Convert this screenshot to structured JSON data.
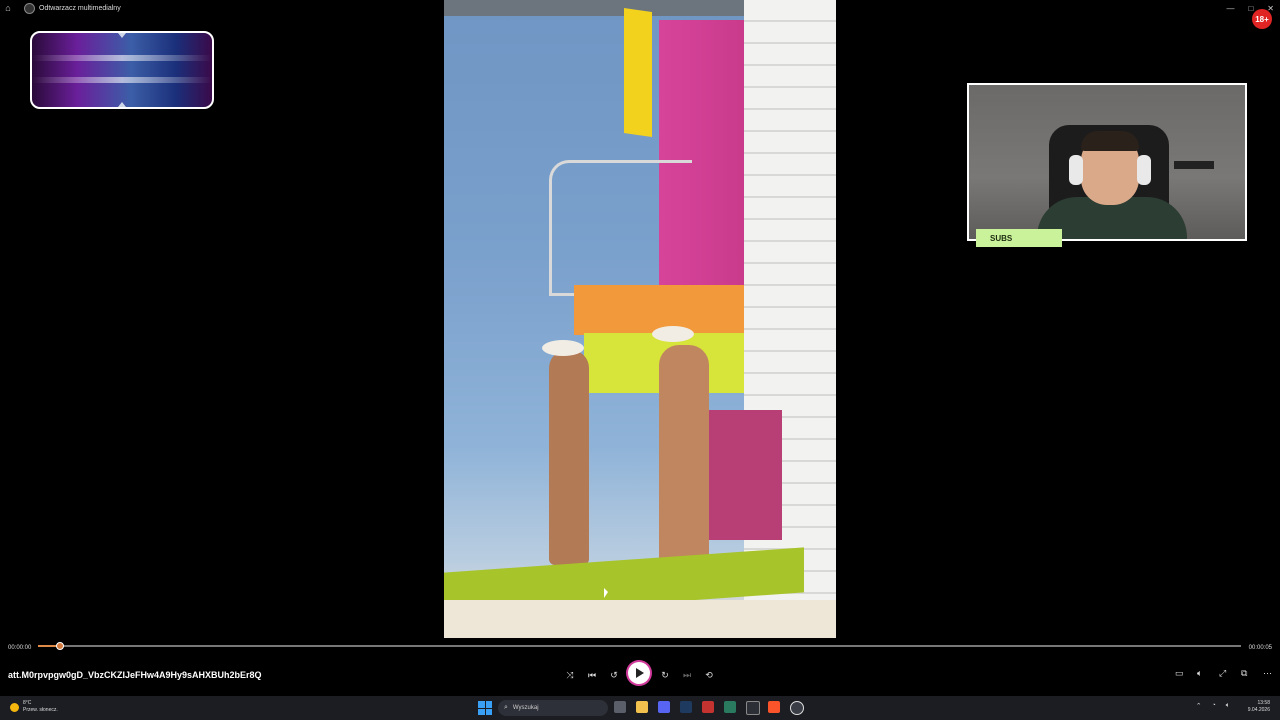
{
  "titlebar": {
    "title": "Odtwarzacz multimedialny",
    "window_buttons": [
      "—",
      "□",
      "✕"
    ]
  },
  "overlay": {
    "badge": "18+",
    "subs_label": "SUBS"
  },
  "player": {
    "time_elapsed": "00:00:00",
    "time_total": "00:00:05",
    "progress": 0.015,
    "filename": "att.M0rpvpgw0gD_VbzCKZIJeFHw4A9Hy9sAHXBUh2bEr8Q"
  },
  "taskbar": {
    "weather_temp": "8°C",
    "weather_desc": "Przew. słonecz.",
    "search_placeholder": "Wyszukaj",
    "time": "13:58",
    "date": "9.04.2026"
  },
  "colors": {
    "accent": "#d13a9b",
    "progress": "#e08a4a",
    "subs_bg": "#c9f29a",
    "badge": "#e02424"
  }
}
